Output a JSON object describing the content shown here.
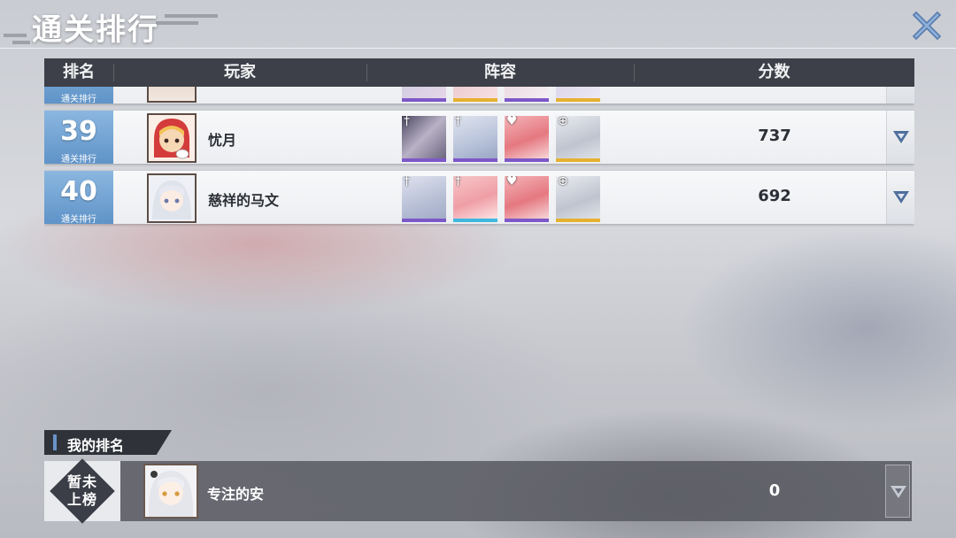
{
  "title": "通关排行",
  "header": {
    "rank": "排名",
    "player": "玩家",
    "lineup": "阵容",
    "score": "分数"
  },
  "rank_caption": "通关排行",
  "rows": [
    {
      "rank": "39",
      "name": "忧月",
      "score": "737",
      "heroes": [
        {
          "icon": "sword-hero-icon",
          "tag": "†"
        },
        {
          "icon": "sword-hero-icon",
          "tag": "†"
        },
        {
          "icon": "heart-hero-icon",
          "tag": "♥"
        },
        {
          "icon": "target-hero-icon",
          "tag": "⊕"
        }
      ]
    },
    {
      "rank": "40",
      "name": "慈祥的马文",
      "score": "692",
      "heroes": [
        {
          "icon": "sword-hero-icon",
          "tag": "†"
        },
        {
          "icon": "sword-hero-icon",
          "tag": "†"
        },
        {
          "icon": "heart-hero-icon",
          "tag": "♥"
        },
        {
          "icon": "target-hero-icon",
          "tag": "⊕"
        }
      ]
    }
  ],
  "my_rank": {
    "tab_label": "我的排名",
    "badge_text": "暂未上榜",
    "name": "专注的安",
    "score": "0"
  },
  "colors": {
    "header_bg": "#3d4048",
    "rank_blue": "#5f93c8",
    "purple_frame": "#7d58c8",
    "gold_frame": "#e6b130"
  }
}
